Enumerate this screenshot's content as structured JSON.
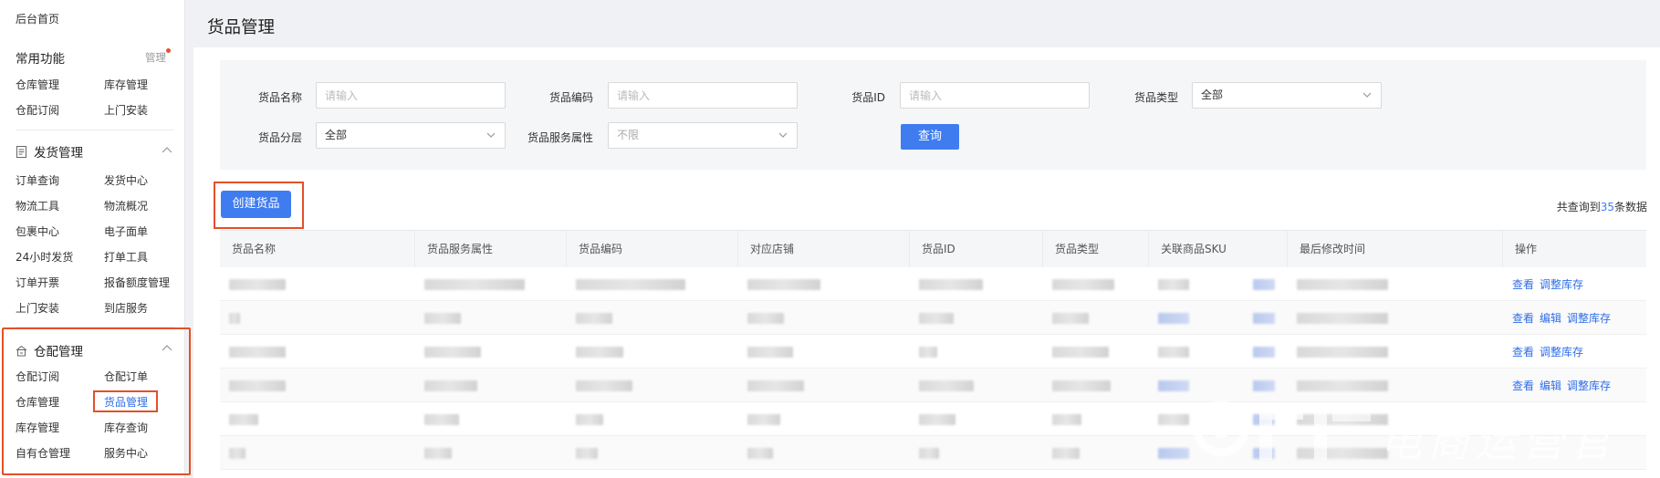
{
  "sidebar": {
    "home": "后台首页",
    "common": {
      "title": "常用功能",
      "manage": "管理",
      "items": [
        "仓库管理",
        "库存管理",
        "仓配订阅",
        "上门安装"
      ]
    },
    "shipping": {
      "title": "发货管理",
      "items": [
        "订单查询",
        "发货中心",
        "物流工具",
        "物流概况",
        "包裹中心",
        "电子面单",
        "24小时发货",
        "打单工具",
        "订单开票",
        "报备额度管理",
        "上门安装",
        "到店服务"
      ]
    },
    "warehouse": {
      "title": "仓配管理",
      "items": [
        "仓配订阅",
        "仓配订单",
        "仓库管理",
        "货品管理",
        "库存管理",
        "库存查询",
        "自有仓管理",
        "服务中心"
      ],
      "active": "货品管理"
    }
  },
  "page": {
    "title": "货品管理"
  },
  "filters": {
    "name_label": "货品名称",
    "name_placeholder": "请输入",
    "code_label": "货品编码",
    "code_placeholder": "请输入",
    "id_label": "货品ID",
    "id_placeholder": "请输入",
    "type_label": "货品类型",
    "type_value": "全部",
    "tier_label": "货品分层",
    "tier_value": "全部",
    "service_label": "货品服务属性",
    "service_value": "不限",
    "query_button": "查询"
  },
  "toolbar": {
    "create_button": "创建货品",
    "result_prefix": "共查询到",
    "result_count": "35",
    "result_suffix": "条数据"
  },
  "table": {
    "columns": [
      "货品名称",
      "货品服务属性",
      "货品编码",
      "对应店铺",
      "货品ID",
      "货品类型",
      "关联商品SKU",
      "最后修改时间",
      "操作"
    ],
    "rows": [
      {
        "ops": [
          "查看",
          "调整库存"
        ]
      },
      {
        "ops": [
          "查看",
          "编辑",
          "调整库存"
        ]
      },
      {
        "ops": [
          "查看",
          "调整库存"
        ]
      },
      {
        "ops": [
          "查看",
          "编辑",
          "调整库存"
        ]
      },
      {
        "ops": []
      },
      {
        "ops": []
      }
    ]
  },
  "watermark": {
    "text": "电商运营官"
  },
  "colors": {
    "primary": "#3f7cf0",
    "highlight": "#e3502a",
    "link": "#2f6ee8"
  }
}
